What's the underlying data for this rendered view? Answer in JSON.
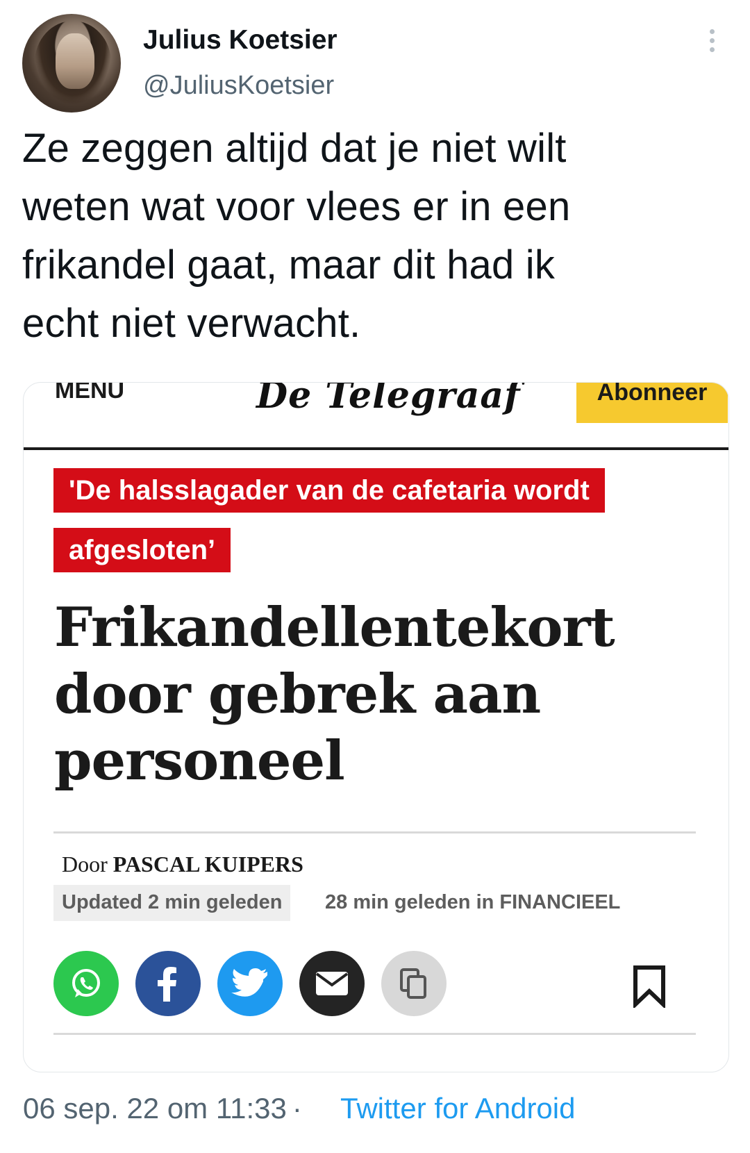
{
  "tweet": {
    "display_name": "Julius Koetsier",
    "handle": "@JuliusKoetsier",
    "text": "Ze zeggen altijd dat je niet wilt\nweten wat voor vlees er in een\nfrikandel gaat, maar dit had ik\necht niet verwacht.",
    "timestamp": "06 sep. 22 om 11:33",
    "separator": "·",
    "source": "Twitter for Android"
  },
  "article": {
    "menu_label": "MENU",
    "logo_text": "De Telegraaf",
    "subscribe_label": "Abonneer",
    "kicker": "'De halsslagader van de cafetaria wordt afgesloten’",
    "headline": "Frikandellentekort door gebrek aan personeel",
    "byline_prefix": "Door",
    "byline_author": "PASCAL KUIPERS",
    "updated": "Updated 2 min geleden",
    "published": "28 min geleden in FINANCIEEL",
    "share_icons": [
      "whatsapp-icon",
      "facebook-icon",
      "twitter-icon",
      "mail-icon",
      "copy-icon"
    ],
    "bookmark_icon": "bookmark-icon"
  },
  "colors": {
    "kicker_bg": "#d40d17",
    "subscribe_bg": "#f6c92f",
    "link": "#1d9bf0",
    "muted": "#536471"
  }
}
